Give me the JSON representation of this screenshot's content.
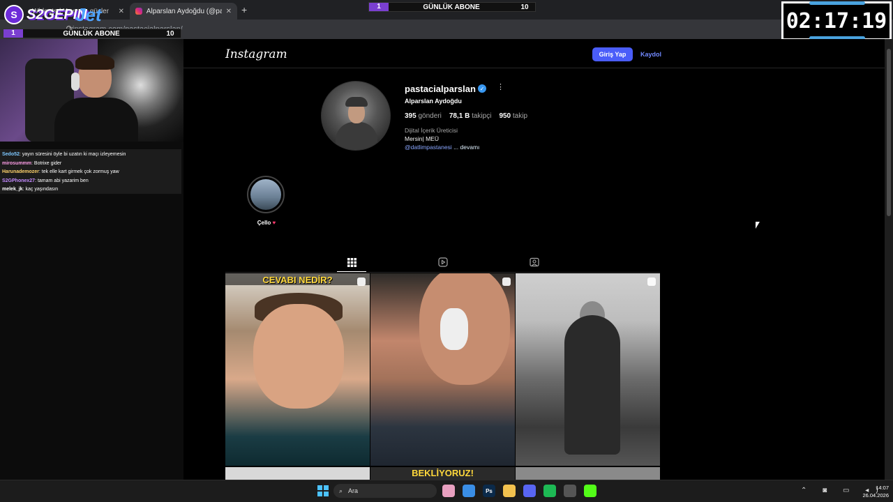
{
  "browser": {
    "tabs": [
      {
        "label": "Widgets | Yayınını güçlendirmek",
        "active": false
      },
      {
        "label": "Alparslan Aydoğdu (@pastacialparslan)",
        "active": true
      }
    ],
    "url": "instagram.com/pastacialparslan/",
    "new_tab": "+",
    "close": "✕"
  },
  "overlay": {
    "logo_text": "S2GEPIN",
    "logo_badge": "S",
    "jet_text": "Jet",
    "goal_top": {
      "num": "1",
      "title": "GÜNLÜK ABONE",
      "target": "10"
    },
    "goal_left": {
      "num": "1",
      "title": "GÜNLÜK ABONE",
      "target": "10"
    },
    "timer": "02:17:19"
  },
  "chat": [
    {
      "user": "Sedo52",
      "color": "#7ec8ff",
      "text": ": yayın süresini öyle bi uzatın ki maçı izleyemesin"
    },
    {
      "user": "mirosummm",
      "color": "#ff9ee8",
      "text": ": Botrixe gider"
    },
    {
      "user": "Harunademozer",
      "color": "#ffd36b",
      "text": ": tek elle kart girmek çok zormuş yaw"
    },
    {
      "user": "S2GPhonex27",
      "color": "#c48bff",
      "text": ": tamam abi yazarim ben"
    },
    {
      "user": "melek_jk",
      "color": "#ffffff",
      "text": ": kaç yaşındasın"
    }
  ],
  "instagram": {
    "logo": "Instagram",
    "login": "Giriş Yap",
    "signup": "Kaydol",
    "username": "pastacialparslan",
    "verified_icon": "✓",
    "more_icon": "⋮",
    "fullname": "Alparslan Aydoğdu",
    "stats": {
      "posts_value": "395",
      "posts_label": "gönderi",
      "followers_value": "78,1 B",
      "followers_label": "takipçi",
      "following_value": "950",
      "following_label": "takip"
    },
    "category": "Dijital İçerik Üreticisi",
    "bio": "Mersin| MEÜ",
    "link_mention": "@datlimpastanesi",
    "link_more": " ... devamı",
    "highlight_label": "Çello",
    "highlight_heart": "♥",
    "tab_icons": [
      "grid-icon",
      "reels-icon",
      "tagged-icon"
    ],
    "posts": [
      {
        "caption": "CEVABI NEDİR?"
      },
      {
        "caption": ""
      },
      {
        "caption": ""
      }
    ],
    "row2_caption": "BEKLİYORUZ!"
  },
  "taskbar": {
    "search_label": "Ara",
    "icons": [
      {
        "name": "paint-icon",
        "label": "",
        "color": "#e8a0c0"
      },
      {
        "name": "chrome-icon",
        "label": "",
        "color": "#3a8ee6"
      },
      {
        "name": "photoshop-icon",
        "label": "Ps",
        "color": "#0b2a4a"
      },
      {
        "name": "folder-icon",
        "label": "",
        "color": "#f2c14e"
      },
      {
        "name": "discord-icon",
        "label": "",
        "color": "#5865f2"
      },
      {
        "name": "spotify-icon",
        "label": "",
        "color": "#1db954"
      },
      {
        "name": "obs-icon",
        "label": "",
        "color": "#555555"
      },
      {
        "name": "kick-icon",
        "label": "",
        "color": "#53fc18"
      }
    ],
    "time": "14:07",
    "date": "26.04.2026"
  }
}
